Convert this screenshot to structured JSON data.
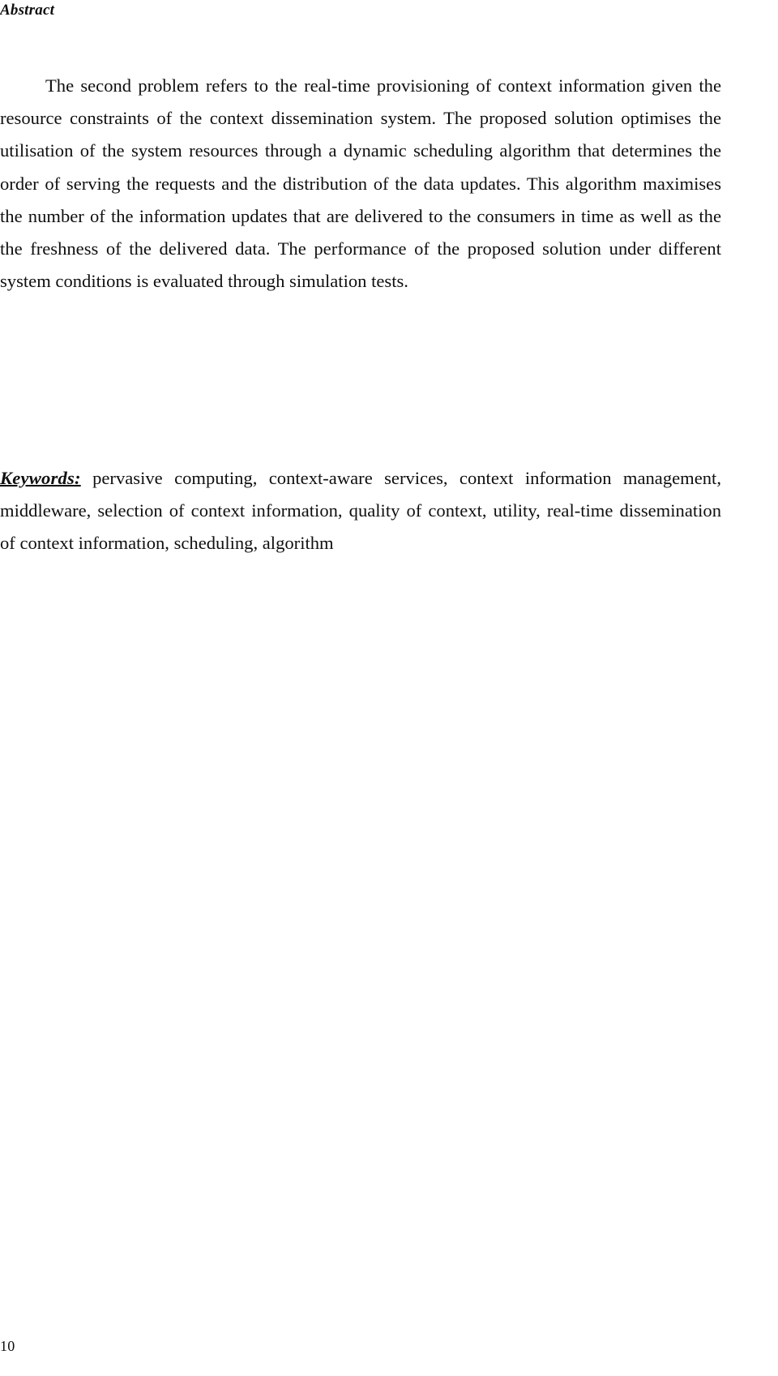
{
  "document": {
    "running_header": "Abstract",
    "page_number": "10",
    "text_color": "#100f0f",
    "background_color": "#ffffff"
  },
  "abstract": {
    "paragraph": "The second problem refers to the real-time provisioning of context information given the resource constraints of the context dissemination system. The proposed solution optimises the utilisation of the system resources through a dynamic scheduling algorithm that determines the order of serving the requests and the distribution of the data updates. This algorithm maximises the number of the information updates that are delivered to the consumers in time as well as the the freshness of the delivered data. The performance of the proposed solution under different system conditions is evaluated through simulation tests."
  },
  "keywords": {
    "label": "Keywords:",
    "list": "pervasive computing, context-aware services, context information management, middleware, selection of context information, quality of context, utility, real-time dissemination of context information, scheduling, algorithm",
    "terms": [
      "pervasive computing",
      "context-aware services",
      "context information management",
      "middleware",
      "selection of context information",
      "quality of context",
      "utility",
      "real-time dissemination of context information",
      "scheduling",
      "algorithm"
    ]
  }
}
